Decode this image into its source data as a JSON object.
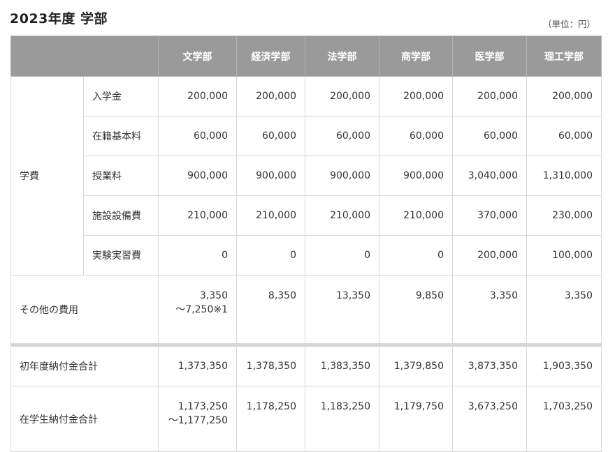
{
  "title": "2023年度 学部",
  "unit_note": "（単位：円）",
  "columns": [
    "文学部",
    "経済学部",
    "法学部",
    "商学部",
    "医学部",
    "理工学部"
  ],
  "tuition_group_label": "学費",
  "tuition_rows": [
    {
      "label": "入学金",
      "values": [
        "200,000",
        "200,000",
        "200,000",
        "200,000",
        "200,000",
        "200,000"
      ]
    },
    {
      "label": "在籍基本料",
      "values": [
        "60,000",
        "60,000",
        "60,000",
        "60,000",
        "60,000",
        "60,000"
      ]
    },
    {
      "label": "授業料",
      "values": [
        "900,000",
        "900,000",
        "900,000",
        "900,000",
        "3,040,000",
        "1,310,000"
      ]
    },
    {
      "label": "施設設備費",
      "values": [
        "210,000",
        "210,000",
        "210,000",
        "210,000",
        "370,000",
        "230,000"
      ]
    },
    {
      "label": "実験実習費",
      "values": [
        "0",
        "0",
        "0",
        "0",
        "200,000",
        "100,000"
      ]
    }
  ],
  "other_row": {
    "label": "その他の費用",
    "first_line1": "3,350",
    "first_line2": "～7,250※1",
    "values": [
      "8,350",
      "13,350",
      "9,850",
      "3,350",
      "3,350"
    ]
  },
  "total_first_year": {
    "label": "初年度納付金合計",
    "values": [
      "1,373,350",
      "1,378,350",
      "1,383,350",
      "1,379,850",
      "3,873,350",
      "1,903,350"
    ]
  },
  "total_enrolled": {
    "label": "在学生納付金合計",
    "first_line1": "1,173,250",
    "first_line2": "～1,177,250",
    "values": [
      "1,178,250",
      "1,183,250",
      "1,179,750",
      "3,673,250",
      "1,703,250"
    ]
  }
}
